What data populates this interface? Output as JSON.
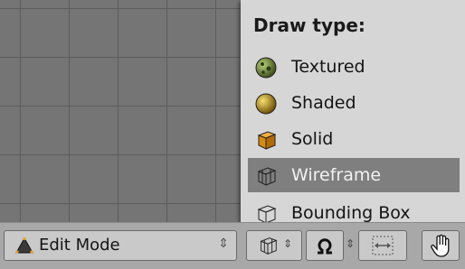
{
  "menu": {
    "title": "Draw type:",
    "items": [
      {
        "label": "Textured",
        "icon": "textured-icon"
      },
      {
        "label": "Shaded",
        "icon": "shaded-icon"
      },
      {
        "label": "Solid",
        "icon": "solid-icon"
      },
      {
        "label": "Wireframe",
        "icon": "wireframe-icon",
        "highlighted": true
      },
      {
        "label": "Bounding Box",
        "icon": "bounding-box-icon"
      }
    ]
  },
  "header": {
    "mode": {
      "label": "Edit Mode",
      "icon": "edit-mode-icon"
    },
    "draw_type_icon": "wireframe-icon",
    "pivot_icon": "pivot-icon",
    "manipulator_icon": "manipulator-icon",
    "hand_icon": "hand-icon"
  },
  "colors": {
    "viewport": "#757575",
    "menu_bg": "#d6d6d6",
    "highlight": "#7f7f7f",
    "header_bg": "#a8a8a8"
  }
}
